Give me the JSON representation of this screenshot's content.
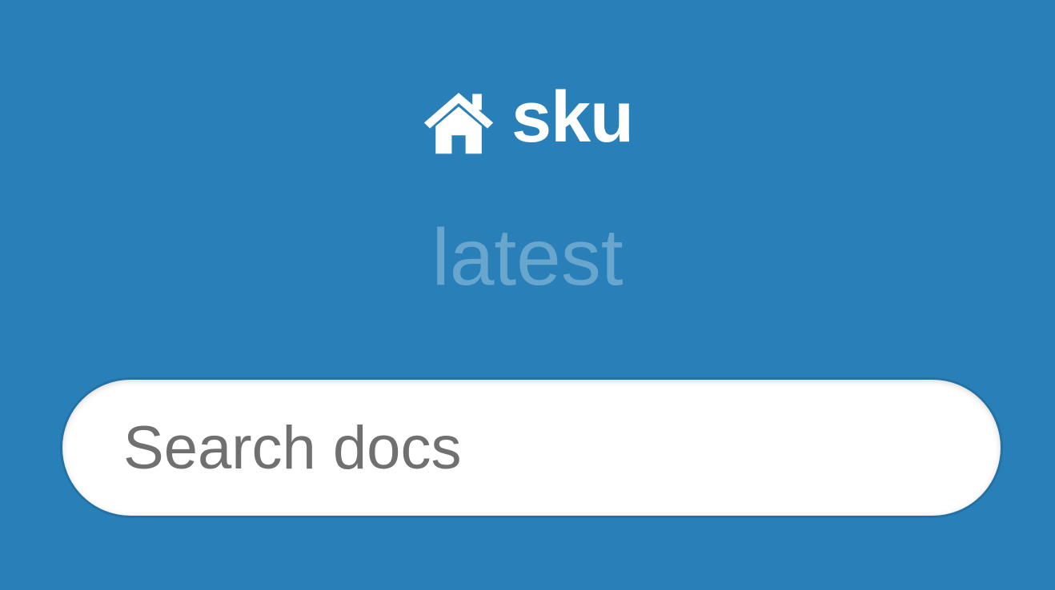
{
  "header": {
    "home_icon": "home-icon",
    "project_name": "sku",
    "version": "latest"
  },
  "search": {
    "placeholder": "Search docs",
    "value": ""
  },
  "colors": {
    "background": "#2980b9",
    "text": "#ffffff",
    "version_text": "rgba(255,255,255,0.3)",
    "placeholder": "#707070"
  }
}
